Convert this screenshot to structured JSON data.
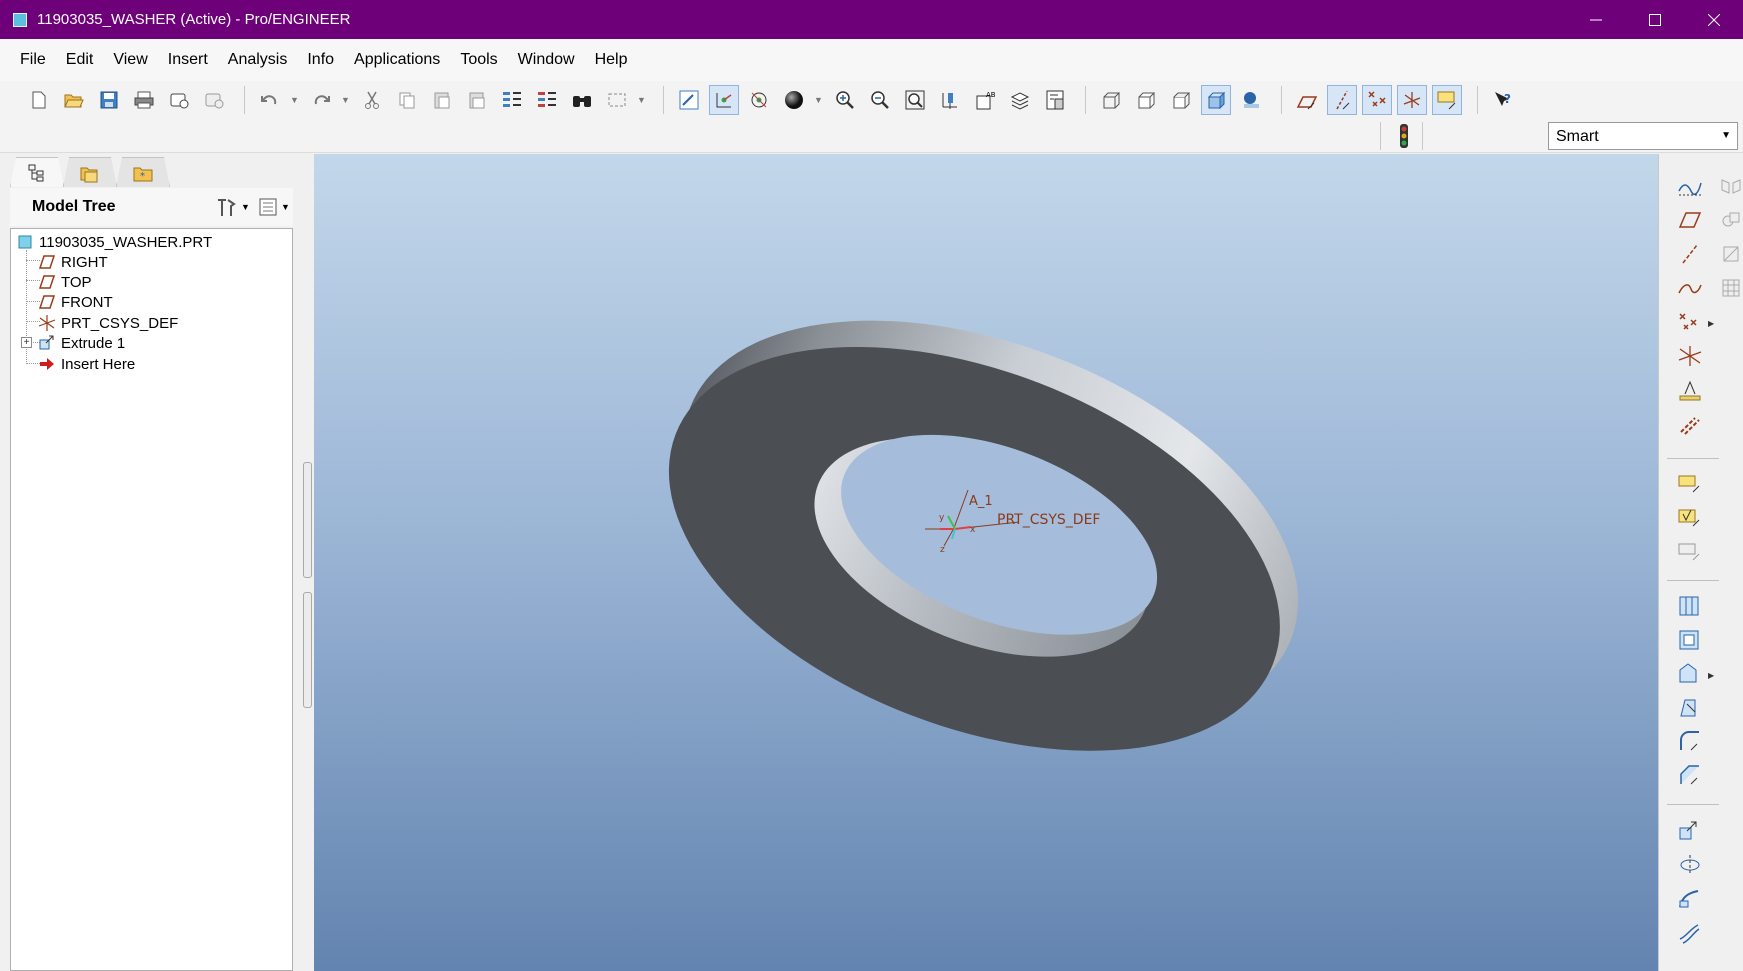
{
  "window": {
    "title": "11903035_WASHER (Active) - Pro/ENGINEER",
    "minimize": "—",
    "maximize": "☐",
    "close": "✕"
  },
  "menu": [
    "File",
    "Edit",
    "View",
    "Insert",
    "Analysis",
    "Info",
    "Applications",
    "Tools",
    "Window",
    "Help"
  ],
  "toolbar": {
    "icons": [
      "new-icon",
      "open-icon",
      "save-icon",
      "print-icon",
      "send-mail-icon",
      "mail-icon",
      "undo-icon",
      "redo-icon",
      "cut-icon",
      "copy-icon",
      "paste-icon",
      "paste-special-icon",
      "regenerate-icon",
      "regen-manager-icon",
      "find-icon",
      "select-box-icon",
      "repaint-icon",
      "spin-center-icon",
      "orient-mode-icon",
      "shading-icon",
      "zoom-in-icon",
      "zoom-out-icon",
      "refit-icon",
      "reorient-icon",
      "saved-views-icon",
      "layers-icon",
      "view-manager-icon",
      "wireframe-icon",
      "hidden-line-icon",
      "no-hidden-icon",
      "shaded-icon",
      "enhanced-realism-icon",
      "datum-planes-icon",
      "datum-axes-icon",
      "datum-points-icon",
      "coord-systems-icon",
      "annotation-display-icon",
      "help-whats-this-icon"
    ]
  },
  "filter": {
    "value": "Smart"
  },
  "model_tree": {
    "title": "Model Tree",
    "items": [
      {
        "label": "11903035_WASHER.PRT",
        "icon": "part-icon"
      },
      {
        "label": "RIGHT",
        "icon": "datum-plane-icon"
      },
      {
        "label": "TOP",
        "icon": "datum-plane-icon"
      },
      {
        "label": "FRONT",
        "icon": "datum-plane-icon"
      },
      {
        "label": "PRT_CSYS_DEF",
        "icon": "coordinate-system-icon"
      },
      {
        "label": "Extrude 1",
        "icon": "extrude-icon"
      },
      {
        "label": "Insert Here",
        "icon": "insert-arrow-icon"
      }
    ]
  },
  "viewport": {
    "axis_label": "A_1",
    "csys_label": "PRT_CSYS_DEF",
    "csys_x": "x",
    "csys_y": "y",
    "csys_z": "z"
  },
  "colors": {
    "titlebar": "#6e007a",
    "washer_face": "#4b4e52",
    "bg_top": "#c3d7ea",
    "bg_bottom": "#6384b0"
  }
}
